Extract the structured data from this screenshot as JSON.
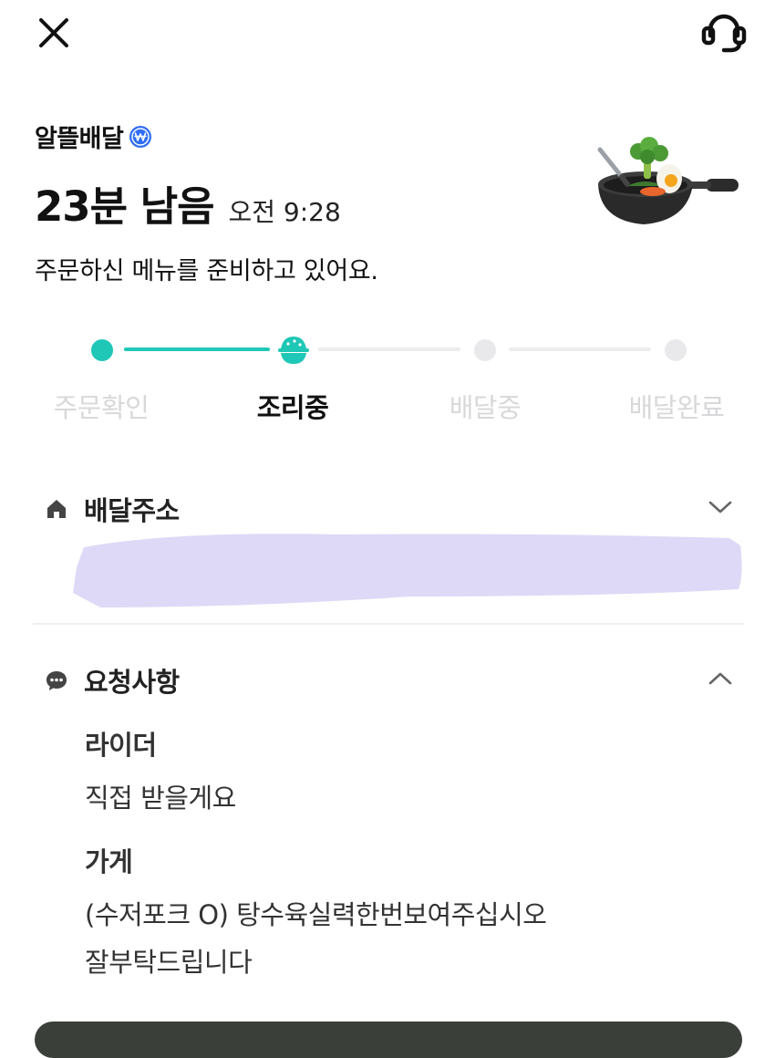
{
  "header": {
    "close_icon": "close-icon",
    "support_icon": "headset-icon"
  },
  "order": {
    "store_name": "알뜰배달",
    "badge_icon": "won-badge-icon",
    "eta_remaining": "23분 남음",
    "eta_time": "오전 9:28",
    "status_message": "주문하신 메뉴를 준비하고 있어요.",
    "illustration_icon": "frying-pan-icon"
  },
  "progress": {
    "current_step": 1,
    "steps": [
      {
        "label": "주문확인",
        "state": "done"
      },
      {
        "label": "조리중",
        "state": "current"
      },
      {
        "label": "배달중",
        "state": "pending"
      },
      {
        "label": "배달완료",
        "state": "pending"
      }
    ],
    "accent_color": "#1fc7b6"
  },
  "address": {
    "title": "배달주소",
    "icon": "home-icon",
    "expanded": false
  },
  "requests": {
    "title": "요청사항",
    "icon": "chat-bubble-icon",
    "expanded": true,
    "rider_label": "라이더",
    "rider_text": "직접 받을게요",
    "store_label": "가게",
    "store_text_line1": "(수저포크 O) 탕수육실력한번보여주십시오",
    "store_text_line2": "잘부탁드립니다"
  }
}
